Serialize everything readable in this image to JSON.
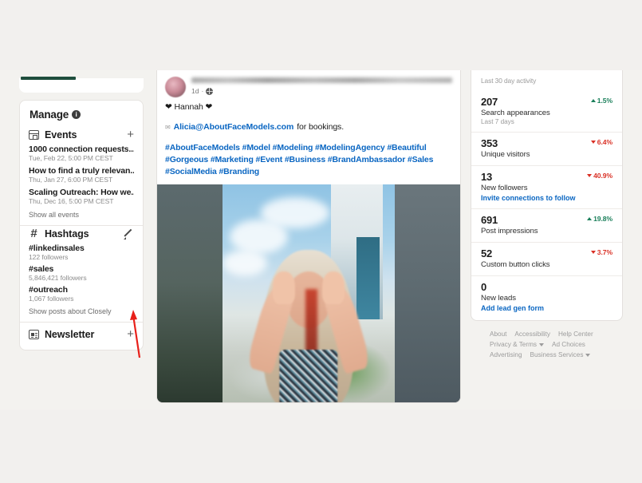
{
  "left_panel": {
    "manage": {
      "title": "Manage",
      "info_icon": "info-icon"
    },
    "events": {
      "section_label": "Events",
      "add_label": "+",
      "items": [
        {
          "title": "1000 connection requests...",
          "date": "Tue, Feb 22, 5:00 PM CEST"
        },
        {
          "title": "How to find a truly relevan...",
          "date": "Thu, Jan 27, 6:00 PM CEST"
        },
        {
          "title": "Scaling Outreach: How we...",
          "date": "Thu, Dec 16, 5:00 PM CEST"
        }
      ],
      "show_all": "Show all events"
    },
    "hashtags": {
      "section_label": "Hashtags",
      "edit_icon": "pencil-icon",
      "items": [
        {
          "name": "#linkedinsales",
          "followers": "122 followers"
        },
        {
          "name": "#sales",
          "followers": "5,846,421 followers"
        },
        {
          "name": "#outreach",
          "followers": "1,067 followers"
        }
      ],
      "show_posts": "Show posts about Closely"
    },
    "newsletter": {
      "section_label": "Newsletter",
      "add_label": "+"
    }
  },
  "feed": {
    "post": {
      "time": "1d",
      "visibility_icon": "globe-icon",
      "heart_line": "❤ Hannah ❤",
      "mail_icon": "envelope-icon",
      "mail_link": "Alicia@AboutFaceModels.com",
      "mail_suffix": "for bookings.",
      "hashtags_line1": "#AboutFaceModels #Model #Modeling #ModelingAgency #Beautiful",
      "hashtags_line2": "#Gorgeous #Marketing #Event #Business #BrandAmbassador #Sales",
      "hashtags_line3": "#SocialMedia #Branding"
    }
  },
  "right_panel": {
    "analytics": {
      "subtitle": "Last 30 day activity",
      "metrics": [
        {
          "value": "207",
          "label": "Search appearances",
          "note": "Last 7 days",
          "delta": "1.5%",
          "direction": "up",
          "link": ""
        },
        {
          "value": "353",
          "label": "Unique visitors",
          "note": "",
          "delta": "6.4%",
          "direction": "down",
          "link": ""
        },
        {
          "value": "13",
          "label": "New followers",
          "note": "",
          "delta": "40.9%",
          "direction": "down",
          "link": "Invite connections to follow"
        },
        {
          "value": "691",
          "label": "Post impressions",
          "note": "",
          "delta": "19.8%",
          "direction": "up",
          "link": ""
        },
        {
          "value": "52",
          "label": "Custom button clicks",
          "note": "",
          "delta": "3.7%",
          "direction": "down",
          "link": ""
        },
        {
          "value": "0",
          "label": "New leads",
          "note": "",
          "delta": "",
          "direction": "none",
          "link": "Add lead gen form"
        }
      ]
    },
    "footer": {
      "links": [
        {
          "label": "About",
          "caret": false
        },
        {
          "label": "Accessibility",
          "caret": false
        },
        {
          "label": "Help Center",
          "caret": false
        },
        {
          "label": "Privacy & Terms",
          "caret": true
        },
        {
          "label": "Ad Choices",
          "caret": false
        },
        {
          "label": "Advertising",
          "caret": false
        },
        {
          "label": "Business Services",
          "caret": true
        }
      ]
    }
  },
  "colors": {
    "accent_green": "#1f4e3d",
    "link_blue": "#0a66c2",
    "positive": "#1a7f5a",
    "negative": "#d93025",
    "annotation_red": "#e8201a",
    "page_bg": "#f3f2ef"
  }
}
